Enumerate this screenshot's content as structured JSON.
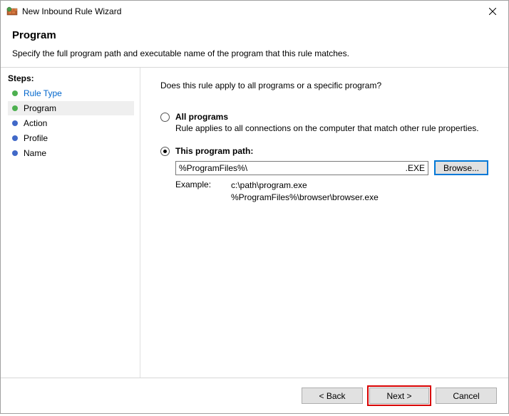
{
  "window": {
    "title": "New Inbound Rule Wizard"
  },
  "header": {
    "title": "Program",
    "description": "Specify the full program path and executable name of the program that this rule matches."
  },
  "sidebar": {
    "title": "Steps:",
    "items": [
      {
        "label": "Rule Type",
        "active": false,
        "completed": true
      },
      {
        "label": "Program",
        "active": true,
        "completed": true
      },
      {
        "label": "Action",
        "active": false,
        "completed": false
      },
      {
        "label": "Profile",
        "active": false,
        "completed": false
      },
      {
        "label": "Name",
        "active": false,
        "completed": false
      }
    ]
  },
  "content": {
    "question": "Does this rule apply to all programs or a specific program?",
    "option_all": {
      "label": "All programs",
      "description": "Rule applies to all connections on the computer that match other rule properties."
    },
    "option_path": {
      "label": "This program path:",
      "value": "%ProgramFiles%\\",
      "suffix": ".EXE",
      "browse": "Browse...",
      "example_label": "Example:",
      "example_line1": "c:\\path\\program.exe",
      "example_line2": "%ProgramFiles%\\browser\\browser.exe"
    }
  },
  "buttons": {
    "back": "< Back",
    "next": "Next >",
    "cancel": "Cancel"
  }
}
